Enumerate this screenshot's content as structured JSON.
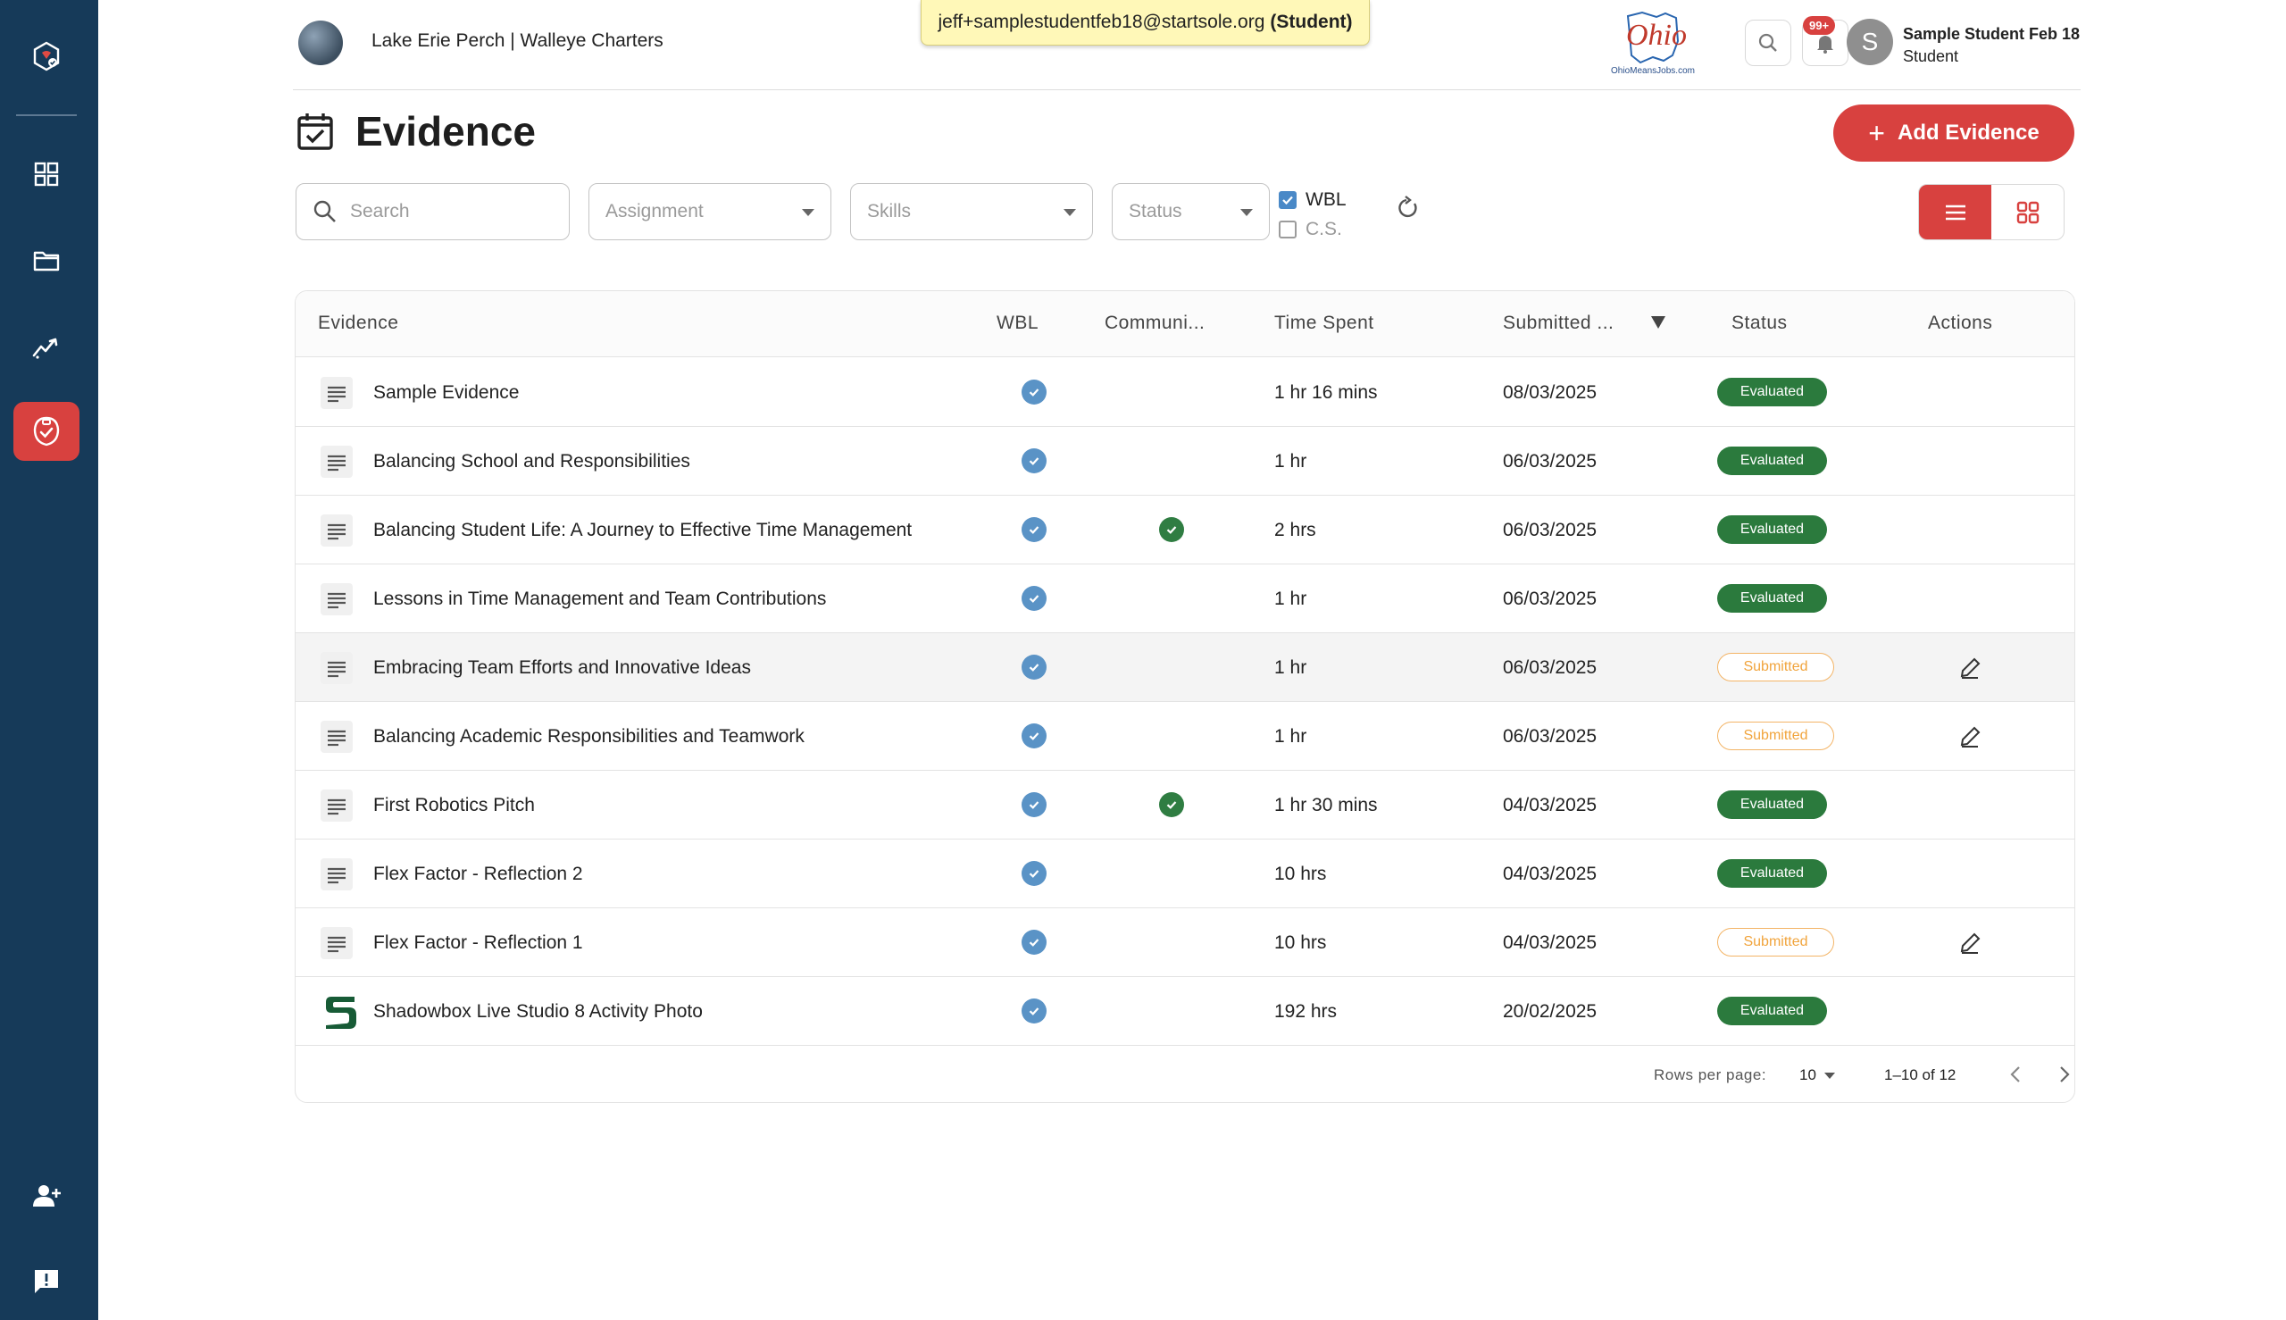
{
  "sidebar": {
    "items": [
      {
        "name": "home-logo-icon"
      },
      {
        "name": "dashboard-icon"
      },
      {
        "name": "folder-icon"
      },
      {
        "name": "analytics-icon"
      },
      {
        "name": "evidence-icon",
        "active": true
      },
      {
        "name": "add-user-icon"
      },
      {
        "name": "feedback-icon"
      }
    ]
  },
  "header": {
    "org_name": "Lake Erie Perch | Walleye Charters",
    "impersonation_email": "jeff+samplestudentfeb18@startsole.org",
    "impersonation_role": "(Student)",
    "ohio_logo_text": "Ohio",
    "ohio_logo_subtext": "OhioMeansJobs.com",
    "notification_count": "99+",
    "user_initial": "S",
    "user_name": "Sample Student Feb 18",
    "user_role": "Student"
  },
  "page": {
    "title": "Evidence",
    "add_button": "Add Evidence"
  },
  "filters": {
    "search_placeholder": "Search",
    "assignment_placeholder": "Assignment",
    "skills_placeholder": "Skills",
    "status_placeholder": "Status",
    "wbl_label": "WBL",
    "wbl_checked": true,
    "cs_label": "C.S.",
    "cs_checked": false,
    "view_mode": "list"
  },
  "table": {
    "headers": {
      "evidence": "Evidence",
      "wbl": "WBL",
      "community": "Communi...",
      "time_spent": "Time Spent",
      "submitted": "Submitted ...",
      "status": "Status",
      "actions": "Actions"
    },
    "rows": [
      {
        "icon": "document-icon",
        "title": "Sample Evidence",
        "wbl": true,
        "community": false,
        "time": "1 hr 16 mins",
        "date": "08/03/2025",
        "status": "Evaluated",
        "editable": false
      },
      {
        "icon": "document-icon",
        "title": "Balancing School and Responsibilities",
        "wbl": true,
        "community": false,
        "time": "1 hr",
        "date": "06/03/2025",
        "status": "Evaluated",
        "editable": false
      },
      {
        "icon": "document-icon",
        "title": "Balancing Student Life: A Journey to Effective Time Management",
        "wbl": true,
        "community": true,
        "time": "2 hrs",
        "date": "06/03/2025",
        "status": "Evaluated",
        "editable": false
      },
      {
        "icon": "document-icon",
        "title": "Lessons in Time Management and Team Contributions",
        "wbl": true,
        "community": false,
        "time": "1 hr",
        "date": "06/03/2025",
        "status": "Evaluated",
        "editable": false
      },
      {
        "icon": "document-icon",
        "title": "Embracing Team Efforts and Innovative Ideas",
        "wbl": true,
        "community": false,
        "time": "1 hr",
        "date": "06/03/2025",
        "status": "Submitted",
        "editable": true,
        "highlighted": true
      },
      {
        "icon": "document-icon",
        "title": "Balancing Academic Responsibilities and Teamwork",
        "wbl": true,
        "community": false,
        "time": "1 hr",
        "date": "06/03/2025",
        "status": "Submitted",
        "editable": true
      },
      {
        "icon": "document-icon",
        "title": "First Robotics Pitch",
        "wbl": true,
        "community": true,
        "time": "1 hr 30 mins",
        "date": "04/03/2025",
        "status": "Evaluated",
        "editable": false
      },
      {
        "icon": "document-icon",
        "title": "Flex Factor - Reflection 2",
        "wbl": true,
        "community": false,
        "time": "10 hrs",
        "date": "04/03/2025",
        "status": "Evaluated",
        "editable": false
      },
      {
        "icon": "document-icon",
        "title": "Flex Factor - Reflection 1",
        "wbl": true,
        "community": false,
        "time": "10 hrs",
        "date": "04/03/2025",
        "status": "Submitted",
        "editable": true
      },
      {
        "icon": "s-logo-icon",
        "title": "Shadowbox Live Studio 8 Activity Photo",
        "wbl": true,
        "community": false,
        "time": "192 hrs",
        "date": "20/02/2025",
        "status": "Evaluated",
        "editable": false
      }
    ]
  },
  "pagination": {
    "rows_per_page_label": "Rows per page:",
    "rows_per_page": "10",
    "range": "1–10 of 12"
  },
  "colors": {
    "sidebar": "#163a59",
    "accent": "#d8413f",
    "evaluated": "#2b7a3d",
    "submitted": "#f1a43c",
    "wbl_check": "#5a93c6"
  }
}
